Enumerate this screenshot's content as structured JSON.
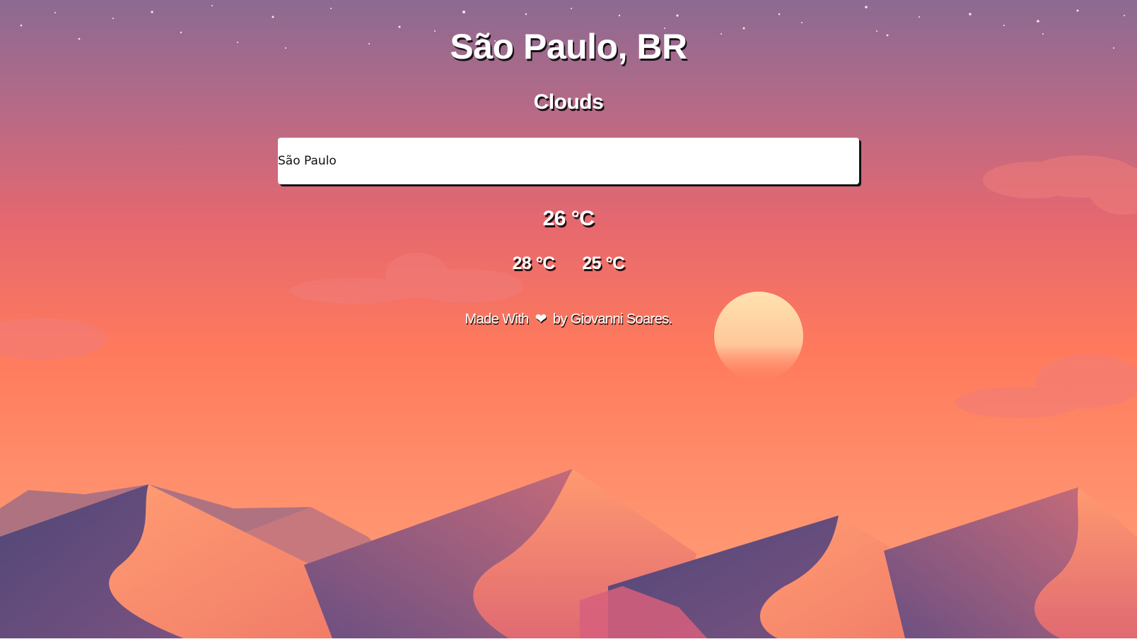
{
  "header": {
    "city": "São Paulo, BR",
    "condition": "Clouds"
  },
  "search": {
    "value": "São Paulo"
  },
  "weather": {
    "current_temp": "26 °C",
    "max_temp": "28 °C",
    "min_temp": "25 °C"
  },
  "footer": {
    "made_with": "Made With",
    "heart": "❤",
    "by": "by Giovanni Soares."
  },
  "colors": {
    "sky_top": "#8e6a92",
    "sky_mid": "#e96872",
    "sky_horizon": "#ff8e6a",
    "sun": "#ffd8a0",
    "dune_shadow": "#5c4a7e",
    "dune_light": "#ff946e"
  },
  "icons": {
    "heart": "heart-icon"
  }
}
